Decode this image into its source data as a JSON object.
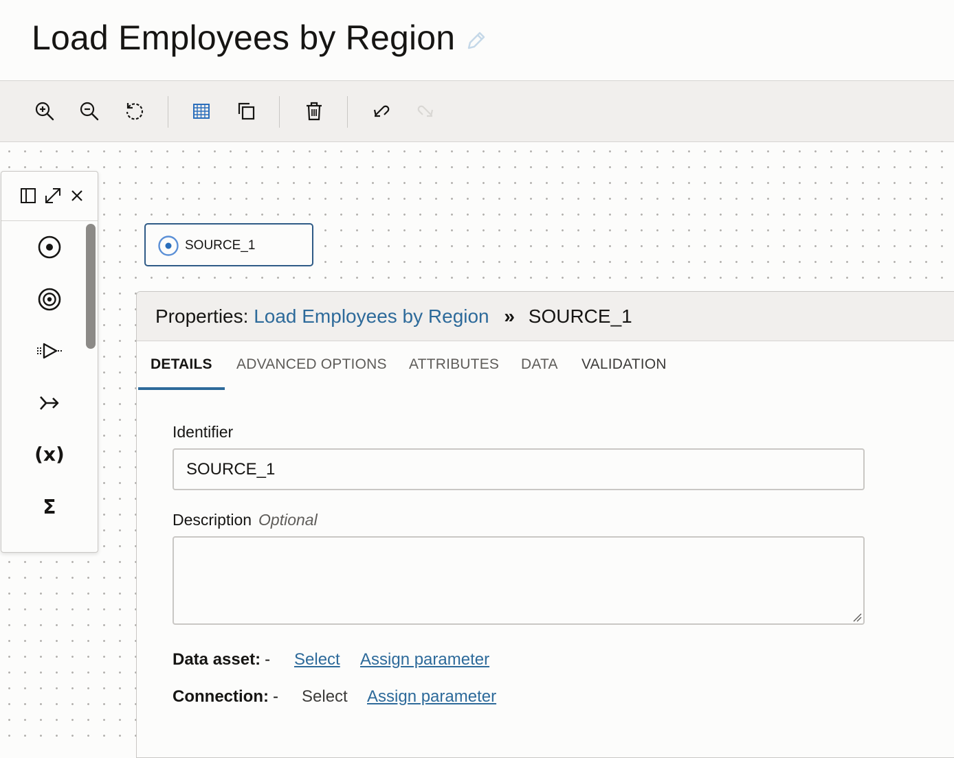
{
  "page": {
    "title": "Load Employees by Region",
    "title_edit_icon": "pencil-icon"
  },
  "toolbar": {
    "buttons": [
      {
        "name": "zoom-in",
        "icon": "zoom-in-icon"
      },
      {
        "name": "zoom-out",
        "icon": "zoom-out-icon"
      },
      {
        "name": "reset-zoom",
        "icon": "refresh-icon"
      },
      {
        "name": "grid",
        "icon": "grid-icon",
        "active": true
      },
      {
        "name": "copy",
        "icon": "copy-icon"
      },
      {
        "name": "delete",
        "icon": "trash-icon"
      },
      {
        "name": "undo",
        "icon": "undo-icon"
      },
      {
        "name": "redo",
        "icon": "redo-icon",
        "disabled": true
      }
    ]
  },
  "palette": {
    "header_icons": [
      "panel-icon",
      "expand-icon",
      "close-icon"
    ],
    "items": [
      {
        "name": "source",
        "icon": "source-icon"
      },
      {
        "name": "target",
        "icon": "target-icon"
      },
      {
        "name": "filter",
        "icon": "filter-icon"
      },
      {
        "name": "join",
        "icon": "join-icon"
      },
      {
        "name": "expression",
        "icon": "expression-icon",
        "glyph": "(x)"
      },
      {
        "name": "aggregate",
        "icon": "aggregate-icon",
        "glyph": "Σ"
      }
    ]
  },
  "canvas": {
    "node": {
      "label": "SOURCE_1",
      "icon": "source-icon"
    }
  },
  "properties": {
    "prefix": "Properties:",
    "flow_link": "Load Employees by Region",
    "separator": "»",
    "current": "SOURCE_1",
    "tabs": [
      {
        "label": "DETAILS",
        "active": true
      },
      {
        "label": "ADVANCED OPTIONS"
      },
      {
        "label": "ATTRIBUTES"
      },
      {
        "label": "DATA"
      },
      {
        "label": "VALIDATION"
      }
    ],
    "identifier_label": "Identifier",
    "identifier_value": "SOURCE_1",
    "description_label": "Description",
    "description_optional": "Optional",
    "description_value": "",
    "data_asset": {
      "label": "Data asset:",
      "value": "-",
      "select": "Select",
      "assign": "Assign parameter"
    },
    "connection": {
      "label": "Connection:",
      "value": "-",
      "select": "Select",
      "assign": "Assign parameter"
    }
  },
  "colors": {
    "accent": "#2d6a9a",
    "node_border": "#2e5a86",
    "grid_icon": "#2a6ebb"
  }
}
